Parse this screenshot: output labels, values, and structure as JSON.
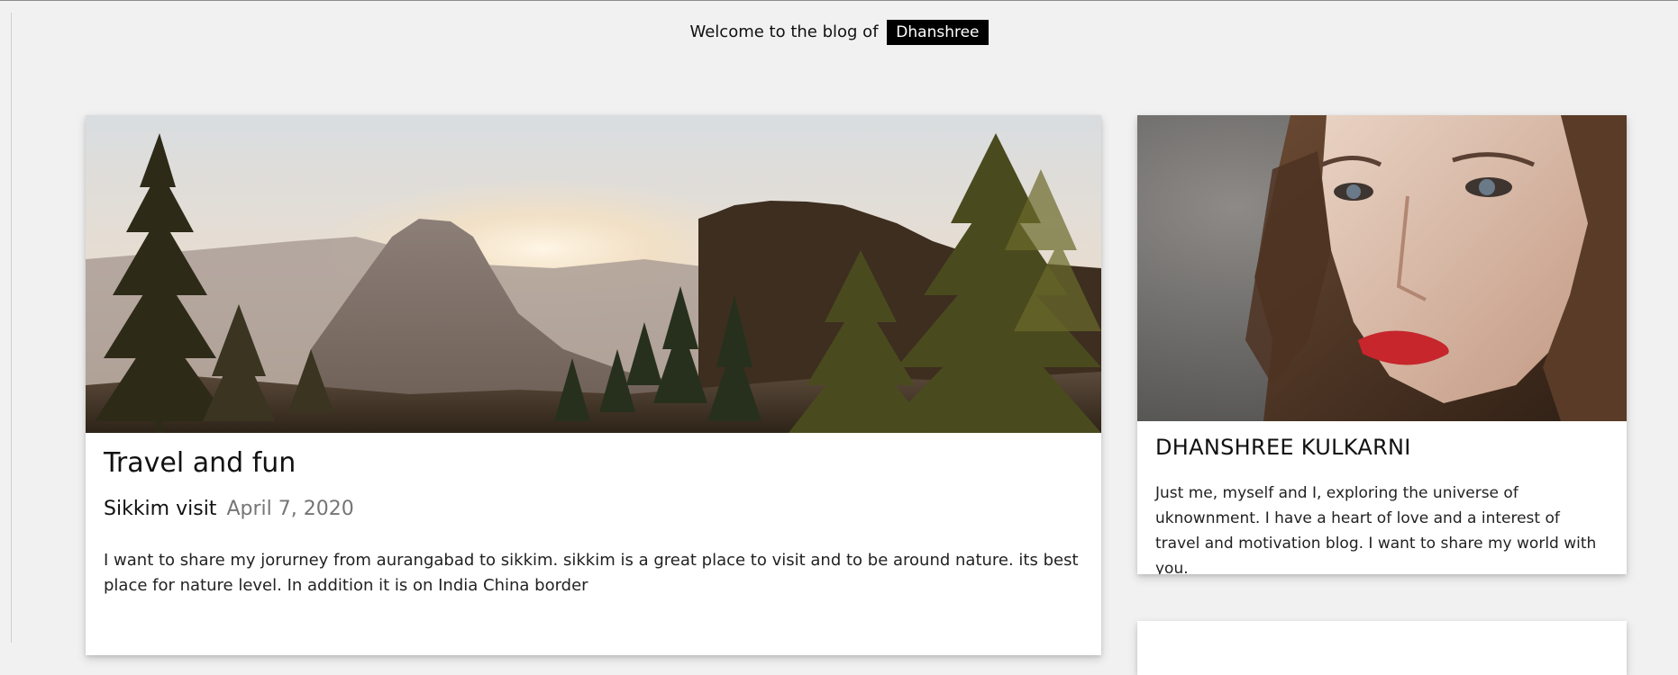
{
  "header": {
    "welcome_text": "Welcome to the blog of",
    "blog_owner": "Dhanshree"
  },
  "post": {
    "title": "Travel and fun",
    "subtitle": "Sikkim visit",
    "date": "April 7, 2020",
    "body": "I want to share my jorurney from aurangabad to sikkim. sikkim is a great place to visit and to be around nature. its best place for nature level. In addition it is on India China border",
    "image_icon": "mountain-sunrise-photo"
  },
  "profile": {
    "name": "DHANSHREE KULKARNI",
    "bio": "Just me, myself and I, exploring the universe of uknownment. I have a heart of love and a interest of travel and motivation blog. I want to share my world with you.",
    "image_icon": "portrait-photo"
  },
  "colors": {
    "page_background": "#f1f1f1",
    "name_tag_background": "#000000",
    "date_text": "#757575"
  }
}
